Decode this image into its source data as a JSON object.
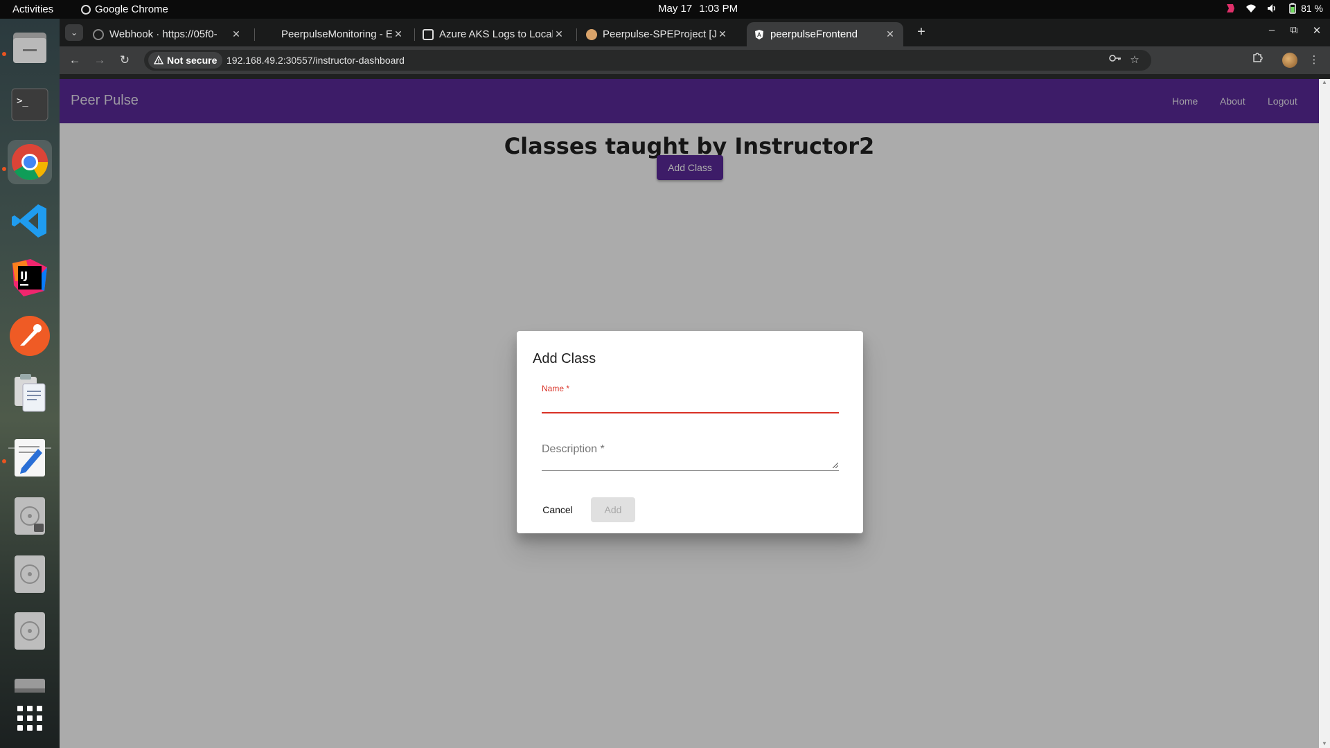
{
  "os": {
    "activities_label": "Activities",
    "app_name": "Google Chrome",
    "date": "May 17",
    "time": "1:03 PM",
    "battery": "81 %"
  },
  "dock": {
    "items": [
      {
        "name": "files",
        "icon": "folder-icon"
      },
      {
        "name": "terminal",
        "icon": "terminal-icon"
      },
      {
        "name": "chrome",
        "icon": "chrome-icon"
      },
      {
        "name": "vscode",
        "icon": "vscode-icon"
      },
      {
        "name": "intellij",
        "icon": "intellij-icon"
      },
      {
        "name": "postman",
        "icon": "postman-icon"
      },
      {
        "name": "clipboard",
        "icon": "clipboard-icon"
      },
      {
        "name": "text-editor",
        "icon": "text-editor-icon"
      },
      {
        "name": "disk-locked",
        "icon": "disk-icon"
      },
      {
        "name": "disk-1",
        "icon": "disk-icon"
      },
      {
        "name": "disk-2",
        "icon": "disk-icon"
      },
      {
        "name": "drive",
        "icon": "drive-icon"
      },
      {
        "name": "app-grid",
        "icon": "app-grid-icon"
      }
    ],
    "intellij_label": "IJ"
  },
  "browser": {
    "tabs": [
      {
        "title": "Webhook · https://05f0-",
        "active": false
      },
      {
        "title": "PeerpulseMonitoring - E",
        "active": false
      },
      {
        "title": "Azure AKS Logs to Local",
        "active": false
      },
      {
        "title": "Peerpulse-SPEProject [Je",
        "active": false
      },
      {
        "title": "peerpulseFrontend",
        "active": true
      }
    ],
    "security_label": "Not secure",
    "url": "192.168.49.2:30557/instructor-dashboard"
  },
  "app": {
    "brand": "Peer Pulse",
    "nav": [
      "Home",
      "About",
      "Logout"
    ],
    "heading": "Classes taught by Instructor2",
    "add_class_label": "Add Class"
  },
  "dialog": {
    "title": "Add Class",
    "name_label": "Name *",
    "name_value": "",
    "description_label": "Description *",
    "cancel_label": "Cancel",
    "add_label": "Add"
  },
  "colors": {
    "appbar": "#5b2b9c",
    "error": "#d93025",
    "disabled_button": "#e0e0e0"
  }
}
